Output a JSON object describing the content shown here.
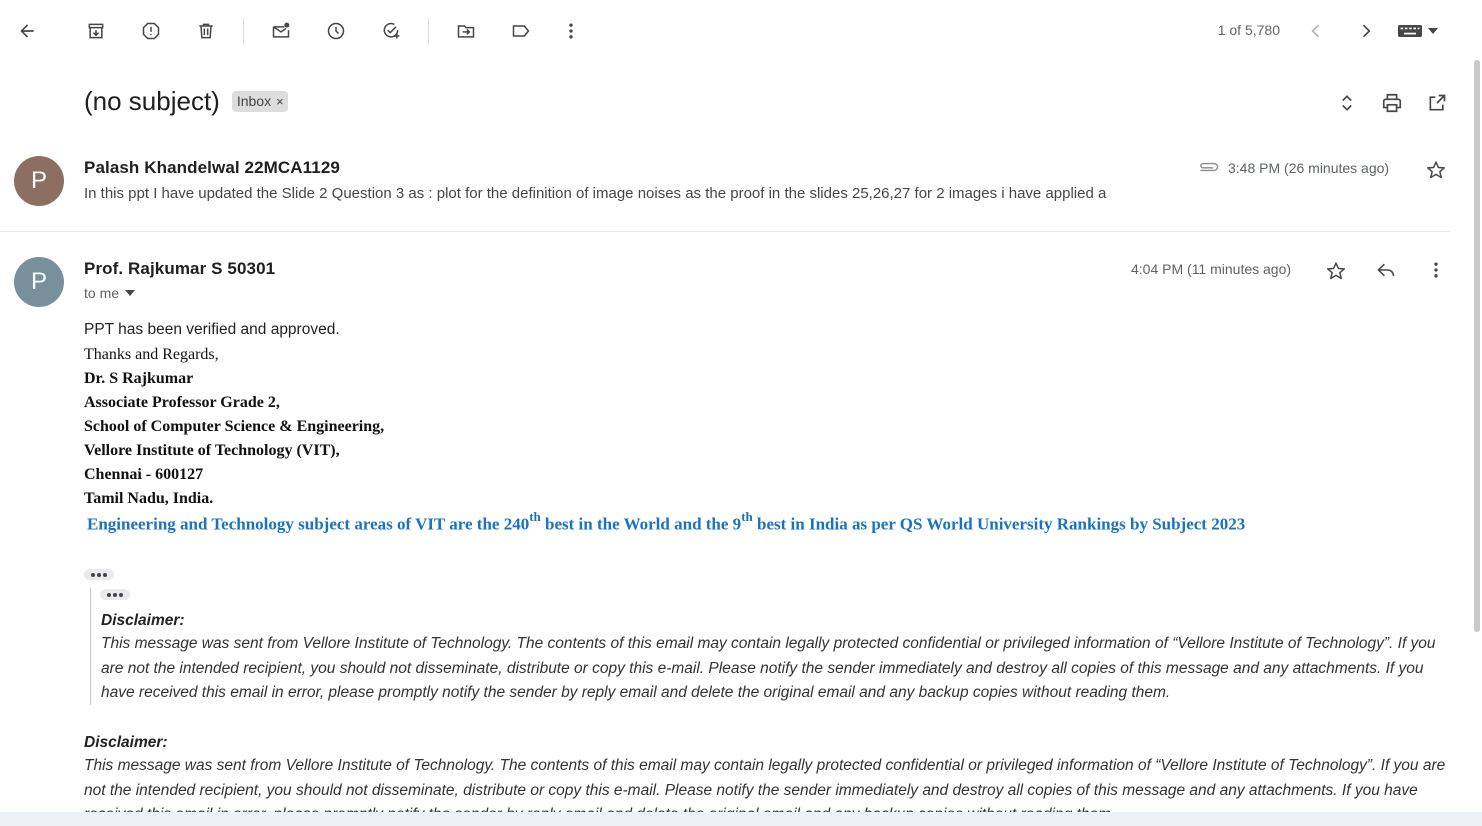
{
  "toolbar": {
    "icons": [
      "back-arrow-icon",
      "archive-icon",
      "report-spam-icon",
      "delete-icon",
      "mark-unread-icon",
      "snooze-icon",
      "add-to-tasks-icon",
      "move-to-icon",
      "label-icon",
      "more-vert-icon"
    ],
    "pager": "1 of 5,780"
  },
  "thread": {
    "subject": "(no subject)",
    "label": "Inbox",
    "label_close": "×"
  },
  "messages": [
    {
      "avatar_letter": "P",
      "avatar_color": "#8d6e63",
      "sender": "Palash Khandelwal 22MCA1129",
      "time": "3:48 PM (26 minutes ago)",
      "snippet": "In this ppt I have updated the Slide 2 Question 3 as : plot for the definition of image noises as the proof in the slides 25,26,27 for 2 images i have applied a"
    },
    {
      "avatar_letter": "P",
      "avatar_color": "#78909c",
      "sender": "Prof. Rajkumar S 50301",
      "time": "4:04 PM (11 minutes ago)",
      "to": "to me",
      "body": "PPT has been verified and approved.",
      "signature": {
        "greeting": "Thanks and Regards,",
        "name": "Dr. S Rajkumar",
        "title": "Associate Professor Grade 2,",
        "school": "School of Computer Science & Engineering,",
        "institute": "Vellore Institute of Technology (VIT),",
        "city": "Chennai - 600127",
        "state": "Tamil Nadu, India."
      },
      "ranking": {
        "part1": "Engineering and Technology subject areas of VIT are the 240",
        "sup1": "th",
        "part2": " best in the World and the 9",
        "sup2": "th",
        "part3": " best in India as per QS World University Rankings by Subject 2023"
      },
      "disclaimer_quoted": {
        "title": "Disclaimer:",
        "text": "This message was sent from Vellore Institute of Technology.  The contents of this email may contain legally protected confidential or privileged information of “Vellore Institute of Technology”.  If you are not the intended recipient, you should not disseminate, distribute or copy this e-mail. Please notify the sender immediately and destroy all copies of this message and any attachments. If you have received this email in error, please promptly notify the sender by reply email and delete the original email and any backup copies without reading them."
      },
      "disclaimer": {
        "title": "Disclaimer:",
        "text": "This message was sent from Vellore Institute of Technology.  The contents of this email may contain legally protected confidential or privileged information of “Vellore Institute of Technology”.  If you are not the intended recipient, you should not disseminate, distribute or copy this e-mail. Please notify the sender immediately and destroy all copies of this message and any attachments. If you have received this email in error, please promptly notify the sender by reply email and delete the original email and any backup copies without reading them."
      }
    }
  ]
}
